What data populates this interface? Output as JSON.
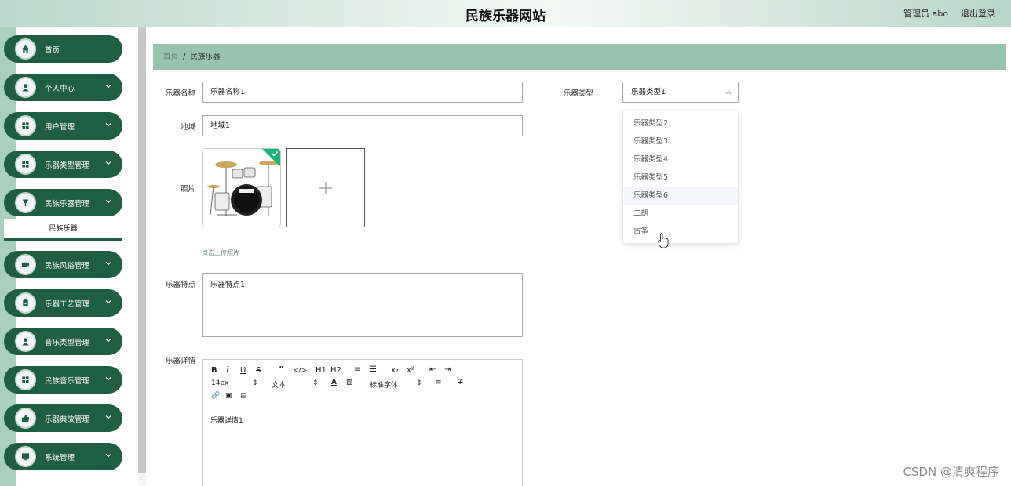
{
  "header": {
    "title": "民族乐器网站",
    "user": "管理员 abo",
    "logout": "退出登录"
  },
  "sidebar": {
    "items": [
      {
        "label": "首页",
        "icon": "home-icon",
        "chevron": false
      },
      {
        "label": "个人中心",
        "icon": "person-icon",
        "chevron": true
      },
      {
        "label": "用户管理",
        "icon": "grid-icon",
        "chevron": true
      },
      {
        "label": "乐器类型管理",
        "icon": "grid-icon",
        "chevron": true
      },
      {
        "label": "民族乐器管理",
        "icon": "pin-icon",
        "chevron": true
      },
      {
        "label": "民族风俗管理",
        "icon": "camera-icon",
        "chevron": true
      },
      {
        "label": "乐器工艺管理",
        "icon": "clipboard-icon",
        "chevron": true
      },
      {
        "label": "音乐类型管理",
        "icon": "person-icon",
        "chevron": true
      },
      {
        "label": "民族音乐管理",
        "icon": "grid-icon",
        "chevron": true
      },
      {
        "label": "乐器典故管理",
        "icon": "thumb-icon",
        "chevron": true
      },
      {
        "label": "系统管理",
        "icon": "monitor-icon",
        "chevron": true
      }
    ],
    "sub_item": "民族乐器"
  },
  "breadcrumb": {
    "home": "首页",
    "separator": "/",
    "current": "民族乐器"
  },
  "form": {
    "name_label": "乐器名称",
    "name_value": "乐器名称1",
    "type_label": "乐器类型",
    "type_value": "乐器类型1",
    "region_label": "地域",
    "region_value": "地域1",
    "photo_label": "照片",
    "upload_hint": "点击上传照片",
    "feature_label": "乐器特点",
    "feature_value": "乐器特点1",
    "detail_label": "乐器详情",
    "detail_value": "乐器详情1"
  },
  "editor_toolbar": {
    "font_size": "14px",
    "text_style": "文本",
    "font_family": "标准字体",
    "h1": "H1",
    "h2": "H2",
    "sub": "x₂",
    "sup": "x²"
  },
  "dropdown": {
    "options": [
      "乐器类型2",
      "乐器类型3",
      "乐器类型4",
      "乐器类型5",
      "乐器类型6",
      "二胡",
      "古筝"
    ],
    "hovered_index": 4
  },
  "watermark": "CSDN @清爽程序",
  "colors": {
    "sidebar_item": "#1f5e43",
    "breadcrumb_bg": "#97c4b0",
    "success": "#18b57a"
  }
}
